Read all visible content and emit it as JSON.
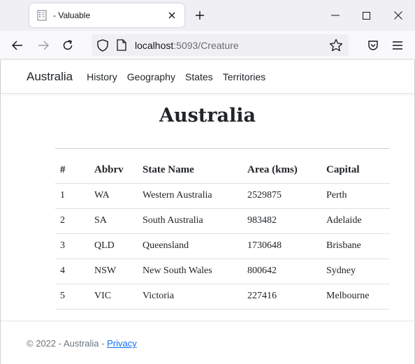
{
  "browser": {
    "tab_title": "- Valuable",
    "url_host": "localhost",
    "url_rest": ":5093/Creature"
  },
  "site": {
    "brand": "Australia",
    "nav": [
      {
        "label": "History"
      },
      {
        "label": "Geography"
      },
      {
        "label": "States"
      },
      {
        "label": "Territories"
      }
    ]
  },
  "main": {
    "title": "Australia",
    "table": {
      "headers": [
        "#",
        "Abbrv",
        "State Name",
        "Area (kms)",
        "Capital"
      ],
      "rows": [
        [
          "1",
          "WA",
          "Western Australia",
          "2529875",
          "Perth"
        ],
        [
          "2",
          "SA",
          "South Australia",
          "983482",
          "Adelaide"
        ],
        [
          "3",
          "QLD",
          "Queensland",
          "1730648",
          "Brisbane"
        ],
        [
          "4",
          "NSW",
          "New South Wales",
          "800642",
          "Sydney"
        ],
        [
          "5",
          "VIC",
          "Victoria",
          "227416",
          "Melbourne"
        ]
      ]
    }
  },
  "footer": {
    "copyright": "© 2022 - Australia - ",
    "privacy_label": "Privacy"
  }
}
